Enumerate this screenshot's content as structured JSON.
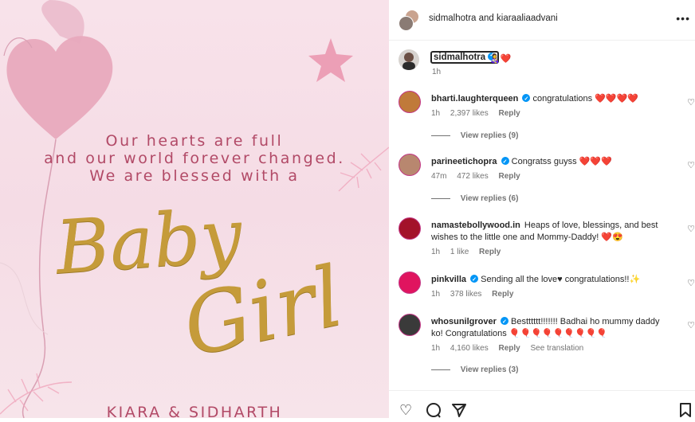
{
  "post": {
    "line1": "Our hearts are full",
    "line2": "and our world forever changed.",
    "line3": "We are blessed with a",
    "word1": "Baby",
    "word2": "Girl",
    "names": "KIARA & SIDHARTH"
  },
  "header": {
    "title": "sidmalhotra and kiaraaliaadvani",
    "more_glyph": "•••"
  },
  "caption": {
    "username": "sidmalhotra",
    "text": "👩‍🍼❤️",
    "time": "1h"
  },
  "comments": [
    {
      "user": "bharti.laughterqueen",
      "verified": true,
      "text": "congratulations ❤️❤️❤️❤️",
      "time": "1h",
      "likes": "2,397 likes",
      "reply": "Reply",
      "view_replies": "View replies (9)"
    },
    {
      "user": "parineetichopra",
      "verified": true,
      "text": "Congratss guyss ❤️❤️❤️",
      "time": "47m",
      "likes": "472 likes",
      "reply": "Reply",
      "view_replies": "View replies (6)"
    },
    {
      "user": "namastebollywood.in",
      "verified": false,
      "text": "Heaps of love, blessings, and best wishes to the little one and Mommy-Daddy! ❤️😍",
      "time": "1h",
      "likes": "1 like",
      "reply": "Reply"
    },
    {
      "user": "pinkvilla",
      "verified": true,
      "text": "Sending all the love♥ congratulations!!✨",
      "time": "1h",
      "likes": "378 likes",
      "reply": "Reply"
    },
    {
      "user": "whosunilgrover",
      "verified": true,
      "text": "Bestttttt!!!!!!! Badhai ho mummy daddy ko! Congratulations 🎈🎈🎈🎈🎈🎈🎈🎈🎈",
      "time": "1h",
      "likes": "4,160 likes",
      "reply": "Reply",
      "translate": "See translation",
      "view_replies": "View replies (3)"
    }
  ],
  "colors": {
    "accent_pink": "#b24a67",
    "gold": "#c59b3a",
    "verified_blue": "#0095f6"
  },
  "icons": [
    "like-icon",
    "comment-icon",
    "share-icon",
    "save-icon"
  ]
}
